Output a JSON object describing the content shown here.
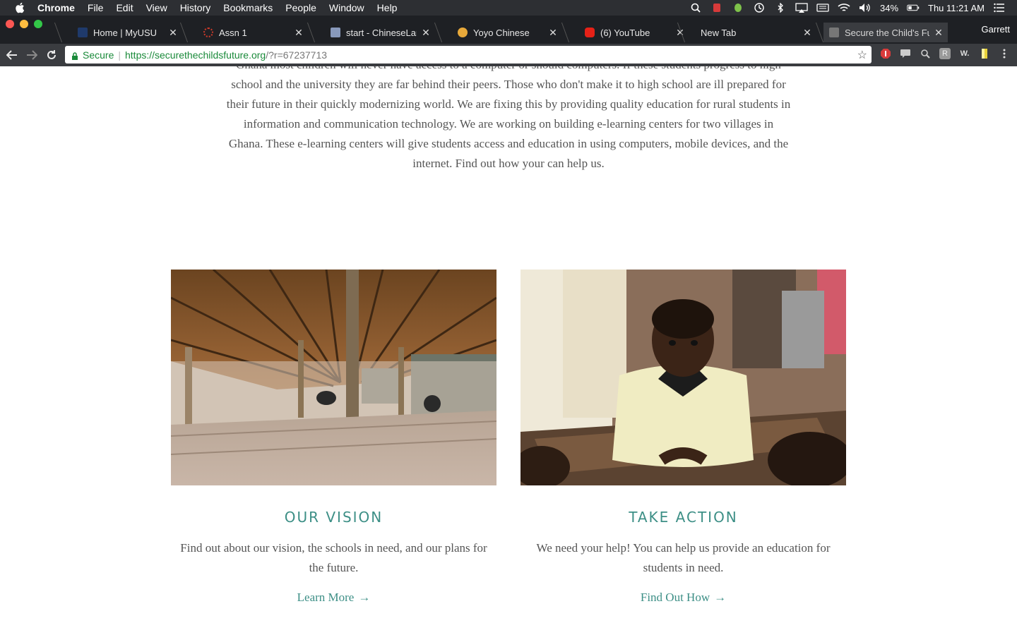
{
  "menubar": {
    "app_name": "Chrome",
    "items": [
      "File",
      "Edit",
      "View",
      "History",
      "Bookmarks",
      "People",
      "Window",
      "Help"
    ],
    "battery": "34%",
    "clock": "Thu 11:21 AM"
  },
  "tabs": [
    {
      "title": "Home | MyUSU",
      "favicon_color": "#1f3a6b"
    },
    {
      "title": "Assn 1",
      "favicon_color": "#cc3a2a"
    },
    {
      "title": "start - ChineseLangua",
      "favicon_color": "#8899bb"
    },
    {
      "title": "Yoyo Chinese",
      "favicon_color": "#e8a93a"
    },
    {
      "title": "(6) YouTube",
      "favicon_color": "#e62117"
    },
    {
      "title": "New Tab",
      "favicon_color": ""
    },
    {
      "title": "Secure the Child's Futu",
      "favicon_color": "#777777"
    }
  ],
  "profile_name": "Garrett",
  "address_bar": {
    "secure_label": "Secure",
    "url_host": "https://securethechildsfuture.org",
    "url_path": "/?r=67237713"
  },
  "intro": {
    "text": "Ghana most children will never have access to a computer or should computers. If these students progress to high school and the university they are far behind their peers. Those who don't make it to high school are ill prepared for their future in their quickly modernizing world. We are fixing this by providing quality education for rural students in information and communication technology. We are working on building e-learning centers for two villages in Ghana. These e-learning centers will give students access and education in using computers, mobile devices, and the internet. Find out how your can help us."
  },
  "cards": [
    {
      "heading": "OUR VISION",
      "description": "Find out about our vision, the schools in need, and our plans for the future.",
      "link_label": "Learn More",
      "link_arrow": "→"
    },
    {
      "heading": "TAKE ACTION",
      "description": "We need your help! You can help us provide an education for students in need.",
      "link_label": "Find Out How",
      "link_arrow": "→"
    }
  ],
  "colors": {
    "accent": "#3d8f86",
    "body_text": "#555555",
    "secure_green": "#1a8a3a"
  }
}
